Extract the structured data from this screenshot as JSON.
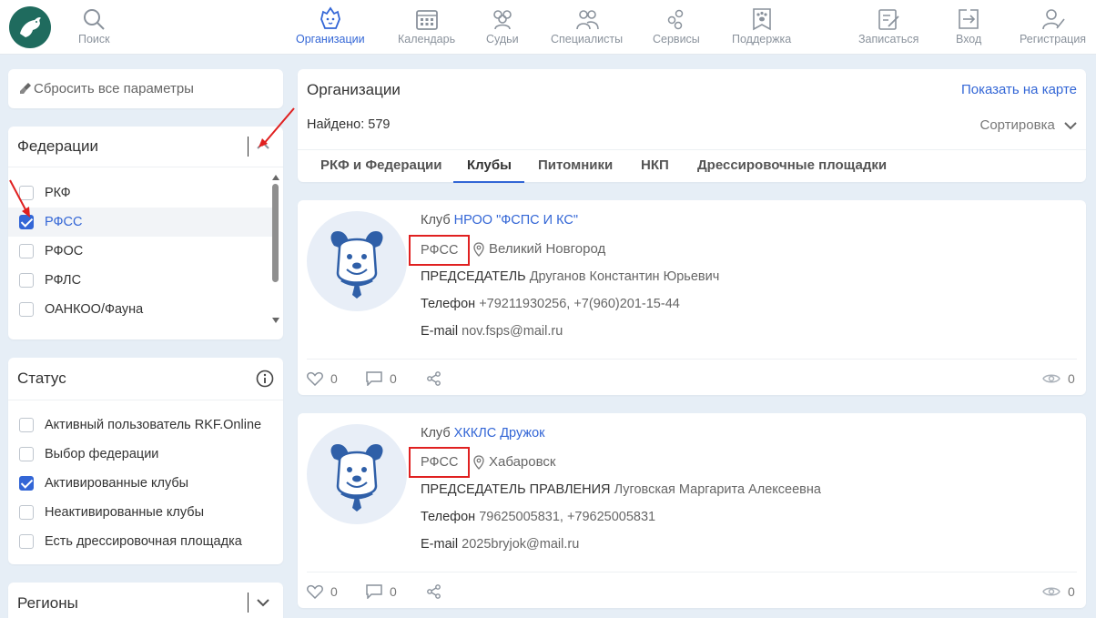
{
  "header": {
    "nav": [
      {
        "id": "search",
        "label": "Поиск",
        "icon": "search-icon",
        "active": false
      },
      {
        "id": "orgs",
        "label": "Организации",
        "icon": "dog-icon",
        "active": true
      },
      {
        "id": "calendar",
        "label": "Календарь",
        "icon": "calendar-icon",
        "active": false
      },
      {
        "id": "judges",
        "label": "Судьи",
        "icon": "judges-icon",
        "active": false
      },
      {
        "id": "specialists",
        "label": "Специалисты",
        "icon": "specialists-icon",
        "active": false
      },
      {
        "id": "services",
        "label": "Сервисы",
        "icon": "gears-icon",
        "active": false
      },
      {
        "id": "support",
        "label": "Поддержка",
        "icon": "paw-icon",
        "active": false
      },
      {
        "id": "signup",
        "label": "Записаться",
        "icon": "edit-icon",
        "active": false
      },
      {
        "id": "login",
        "label": "Вход",
        "icon": "login-icon",
        "active": false
      },
      {
        "id": "register",
        "label": "Регистрация",
        "icon": "register-icon",
        "active": false
      }
    ]
  },
  "sidebar": {
    "reset_label": "Сбросить все параметры",
    "federations": {
      "title": "Федерации",
      "items": [
        {
          "label": "РКФ",
          "checked": false
        },
        {
          "label": "РФСС",
          "checked": true
        },
        {
          "label": "РФОС",
          "checked": false
        },
        {
          "label": "РФЛС",
          "checked": false
        },
        {
          "label": "ОАНКОО/Фауна",
          "checked": false
        }
      ]
    },
    "status": {
      "title": "Статус",
      "items": [
        {
          "label": "Активный пользователь RKF.Online",
          "checked": false
        },
        {
          "label": "Выбор федерации",
          "checked": false
        },
        {
          "label": "Активированные клубы",
          "checked": true
        },
        {
          "label": "Неактивированные клубы",
          "checked": false
        },
        {
          "label": "Есть дрессировочная площадка",
          "checked": false
        }
      ]
    },
    "regions": {
      "title": "Регионы"
    }
  },
  "main": {
    "title": "Организации",
    "map_link": "Показать на карте",
    "found": "Найдено: 579",
    "sort": "Сортировка",
    "tabs": [
      {
        "label": "РКФ и Федерации",
        "active": false
      },
      {
        "label": "Клубы",
        "active": true
      },
      {
        "label": "Питомники",
        "active": false
      },
      {
        "label": "НКП",
        "active": false
      },
      {
        "label": "Дрессировочные площадки",
        "active": false
      }
    ]
  },
  "clubs": [
    {
      "prefix": "Клуб",
      "name": "НРОО \"ФСПС И КС\"",
      "federation": "РФСС",
      "city": "Великий Новгород",
      "chair_label": "ПРЕДСЕДАТЕЛЬ",
      "chair_name": "Друганов Константин Юрьевич",
      "phone_label": "Телефон",
      "phone": "+79211930256, +7(960)201-15-44",
      "email_label": "E-mail",
      "email": "nov.fsps@mail.ru",
      "likes": "0",
      "comments": "0",
      "views": "0"
    },
    {
      "prefix": "Клуб",
      "name": "ХККЛС Дружок",
      "federation": "РФСС",
      "city": "Хабаровск",
      "chair_label": "ПРЕДСЕДАТЕЛЬ ПРАВЛЕНИЯ",
      "chair_name": "Луговская Маргарита Алексеевна",
      "phone_label": "Телефон",
      "phone": "79625005831, +79625005831",
      "email_label": "E-mail",
      "email": "2025bryjok@mail.ru",
      "likes": "0",
      "comments": "0",
      "views": "0"
    }
  ],
  "colors": {
    "accent": "#3366d6",
    "highlight": "#e02020",
    "logo": "#1f6b5e"
  }
}
